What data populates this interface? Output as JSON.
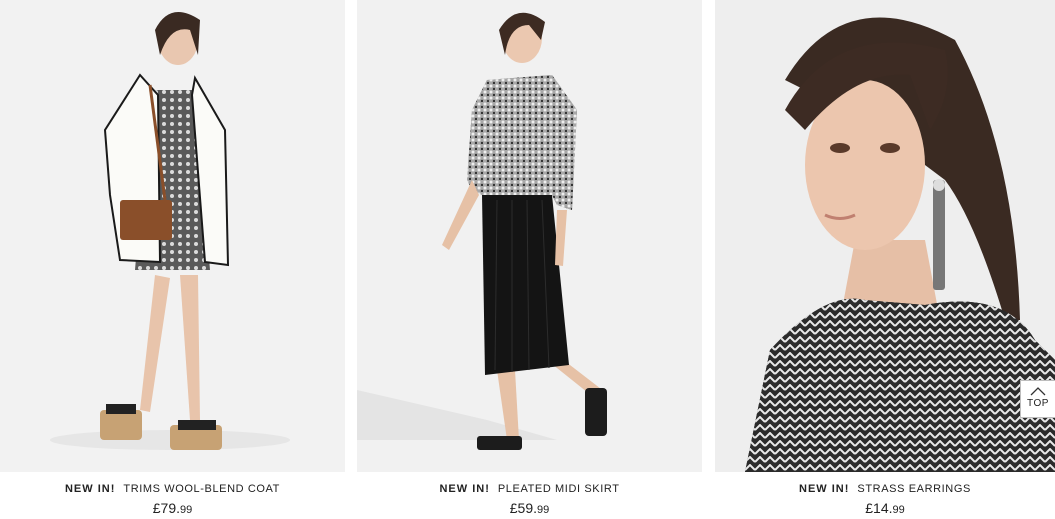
{
  "products": [
    {
      "tag": "NEW IN!",
      "name": "TRIMS WOOL-BLEND COAT",
      "price_main": "£79.",
      "price_cents": "99",
      "image": "model-wool-coat-photo"
    },
    {
      "tag": "NEW IN!",
      "name": "PLEATED MIDI SKIRT",
      "price_main": "£59.",
      "price_cents": "99",
      "image": "model-pleated-skirt-photo"
    },
    {
      "tag": "NEW IN!",
      "name": "STRASS EARRINGS",
      "price_main": "£14.",
      "price_cents": "99",
      "image": "model-earrings-closeup-photo"
    }
  ],
  "scroll_top": {
    "label": "TOP",
    "icon": "chevron-up-icon"
  }
}
